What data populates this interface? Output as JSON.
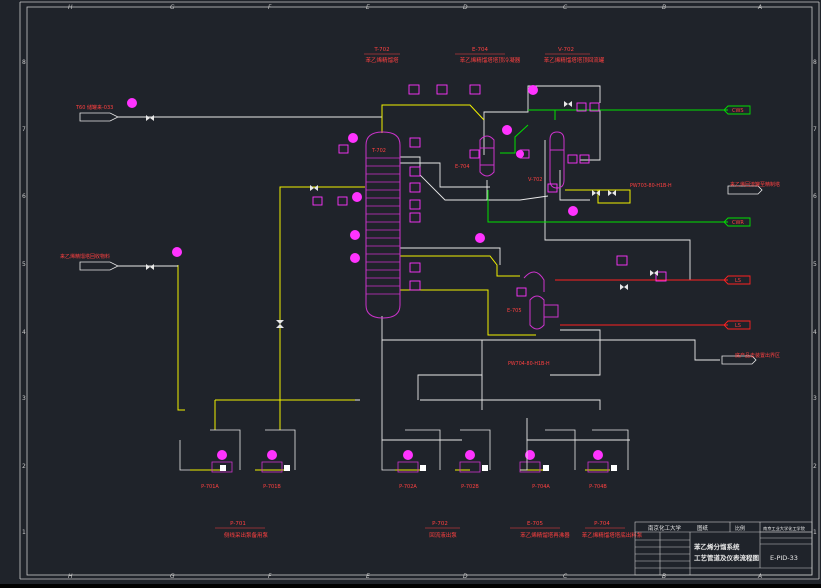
{
  "drawing": {
    "frame_cols": [
      "H",
      "G",
      "F",
      "E",
      "D",
      "C",
      "B",
      "A"
    ],
    "frame_rows": [
      "8",
      "7",
      "6",
      "5",
      "4",
      "3",
      "2",
      "1"
    ],
    "feed_left_top": "T60 储罐来-033",
    "feed_left_mid": "来乙烯精馏塔回收物料",
    "stream_outlets": {
      "cws": "CWS",
      "cwr": "CWR",
      "ls_top": "LS",
      "ls_bottom": "LS"
    },
    "outlet_labels": {
      "right_upper": "来乙烯回流罐至精制塔",
      "right_lower": "底产品去装置出界区"
    },
    "line_numbers": {
      "upper": "PW703-80-H1B-H",
      "lower": "PW704-80-H1B-H"
    },
    "equipment_tags": {
      "column": "T-702",
      "condenser": "E-704",
      "drum": "V-702",
      "reboiler": "E-705",
      "condenser_side": "E-704"
    },
    "pump_tags": [
      "P-701A",
      "P-701B",
      "P-702A",
      "P-702B",
      "P-704A",
      "P-704B"
    ],
    "top_headers": [
      {
        "tag": "T-702",
        "name": "苯乙烯精馏塔"
      },
      {
        "tag": "E-704",
        "name": "苯乙烯精馏塔塔顶冷凝器"
      },
      {
        "tag": "V-702",
        "name": "苯乙烯精馏塔塔顶回流罐"
      }
    ],
    "bottom_headers": [
      {
        "tag": "P-701",
        "name": "侧线采出泵备用泵"
      },
      {
        "tag": "P-702",
        "name": "回流液出泵"
      },
      {
        "tag": "E-705",
        "name": "苯乙烯精馏塔再沸器"
      },
      {
        "tag": "P-704",
        "name": "苯乙烯精馏塔塔底出料泵"
      }
    ],
    "title_block": {
      "company": "南京化工大学",
      "project_col": "图纸",
      "scale_col": "比例",
      "school": "南京工业大学化工学院",
      "title_line1": "苯乙烯分馏系统",
      "title_line2": "工艺管道及仪表流程图",
      "drawing_no": "E-PID-33"
    }
  },
  "colors": {
    "background": "#1f232a",
    "frame": "#c8c8c8",
    "process_line": "#f2f200",
    "cooling_water": "#00e000",
    "steam": "#ff2020",
    "equipment": "#cc33cc",
    "instrument": "#ff33ff",
    "label": "#ff4040",
    "white_line": "#e8e8e8"
  }
}
